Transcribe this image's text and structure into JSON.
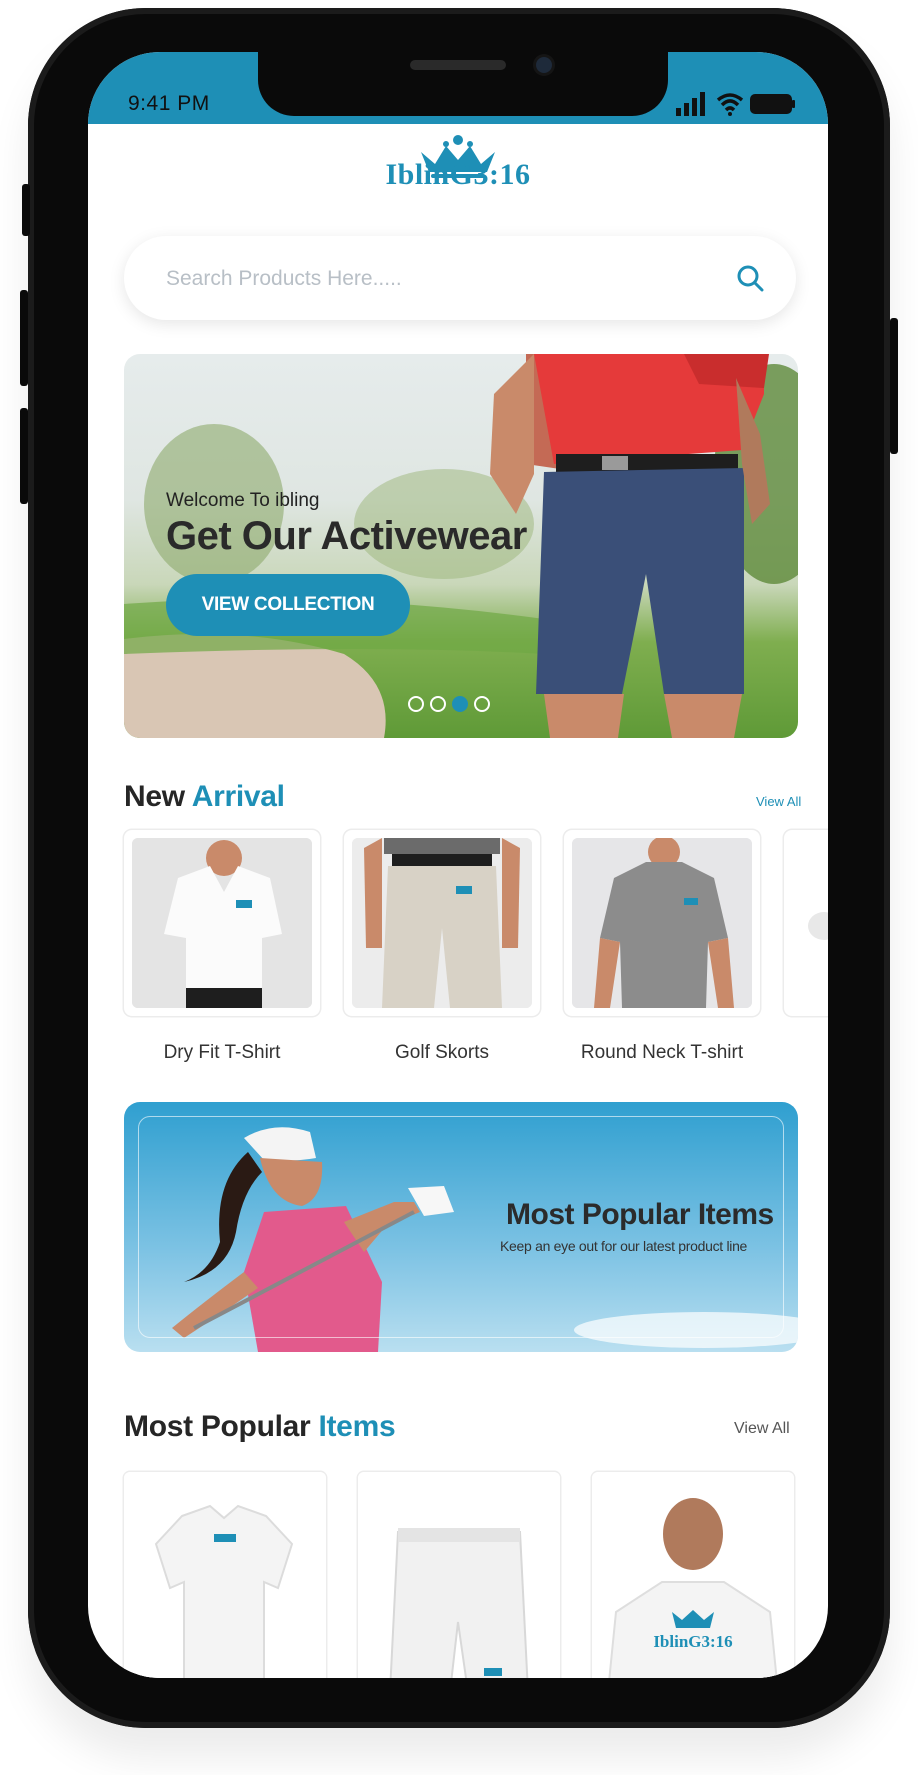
{
  "status_bar": {
    "time": "9:41 PM"
  },
  "brand": {
    "logo_text": "IblinG3:16"
  },
  "search": {
    "placeholder": "Search Products Here....."
  },
  "hero": {
    "welcome": "Welcome To ibling",
    "title": "Get Our Activewear",
    "button_label": "VIEW COLLECTION",
    "slides_total": 4,
    "active_slide": 3
  },
  "new_arrival": {
    "title_plain": "New",
    "title_accent": "Arrival",
    "view_all": "View All",
    "items": [
      {
        "label": "Dry Fit T-Shirt"
      },
      {
        "label": "Golf Skorts"
      },
      {
        "label": "Round Neck T-shirt"
      }
    ]
  },
  "promo": {
    "title": "Most Popular Items",
    "subtitle": "Keep an eye out for our latest product line"
  },
  "popular": {
    "title_plain": "Most Popular",
    "title_accent": "Items",
    "view_all": "View All",
    "tshirt_logo_text": "IblinG3:16"
  },
  "colors": {
    "accent": "#1e8fb6",
    "text_dark": "#262626",
    "status_bar": "#1e8fb6"
  },
  "icons": {
    "signal": "signal-icon",
    "wifi": "wifi-icon",
    "battery": "battery-icon",
    "search": "search-icon",
    "crown": "crown-icon"
  }
}
